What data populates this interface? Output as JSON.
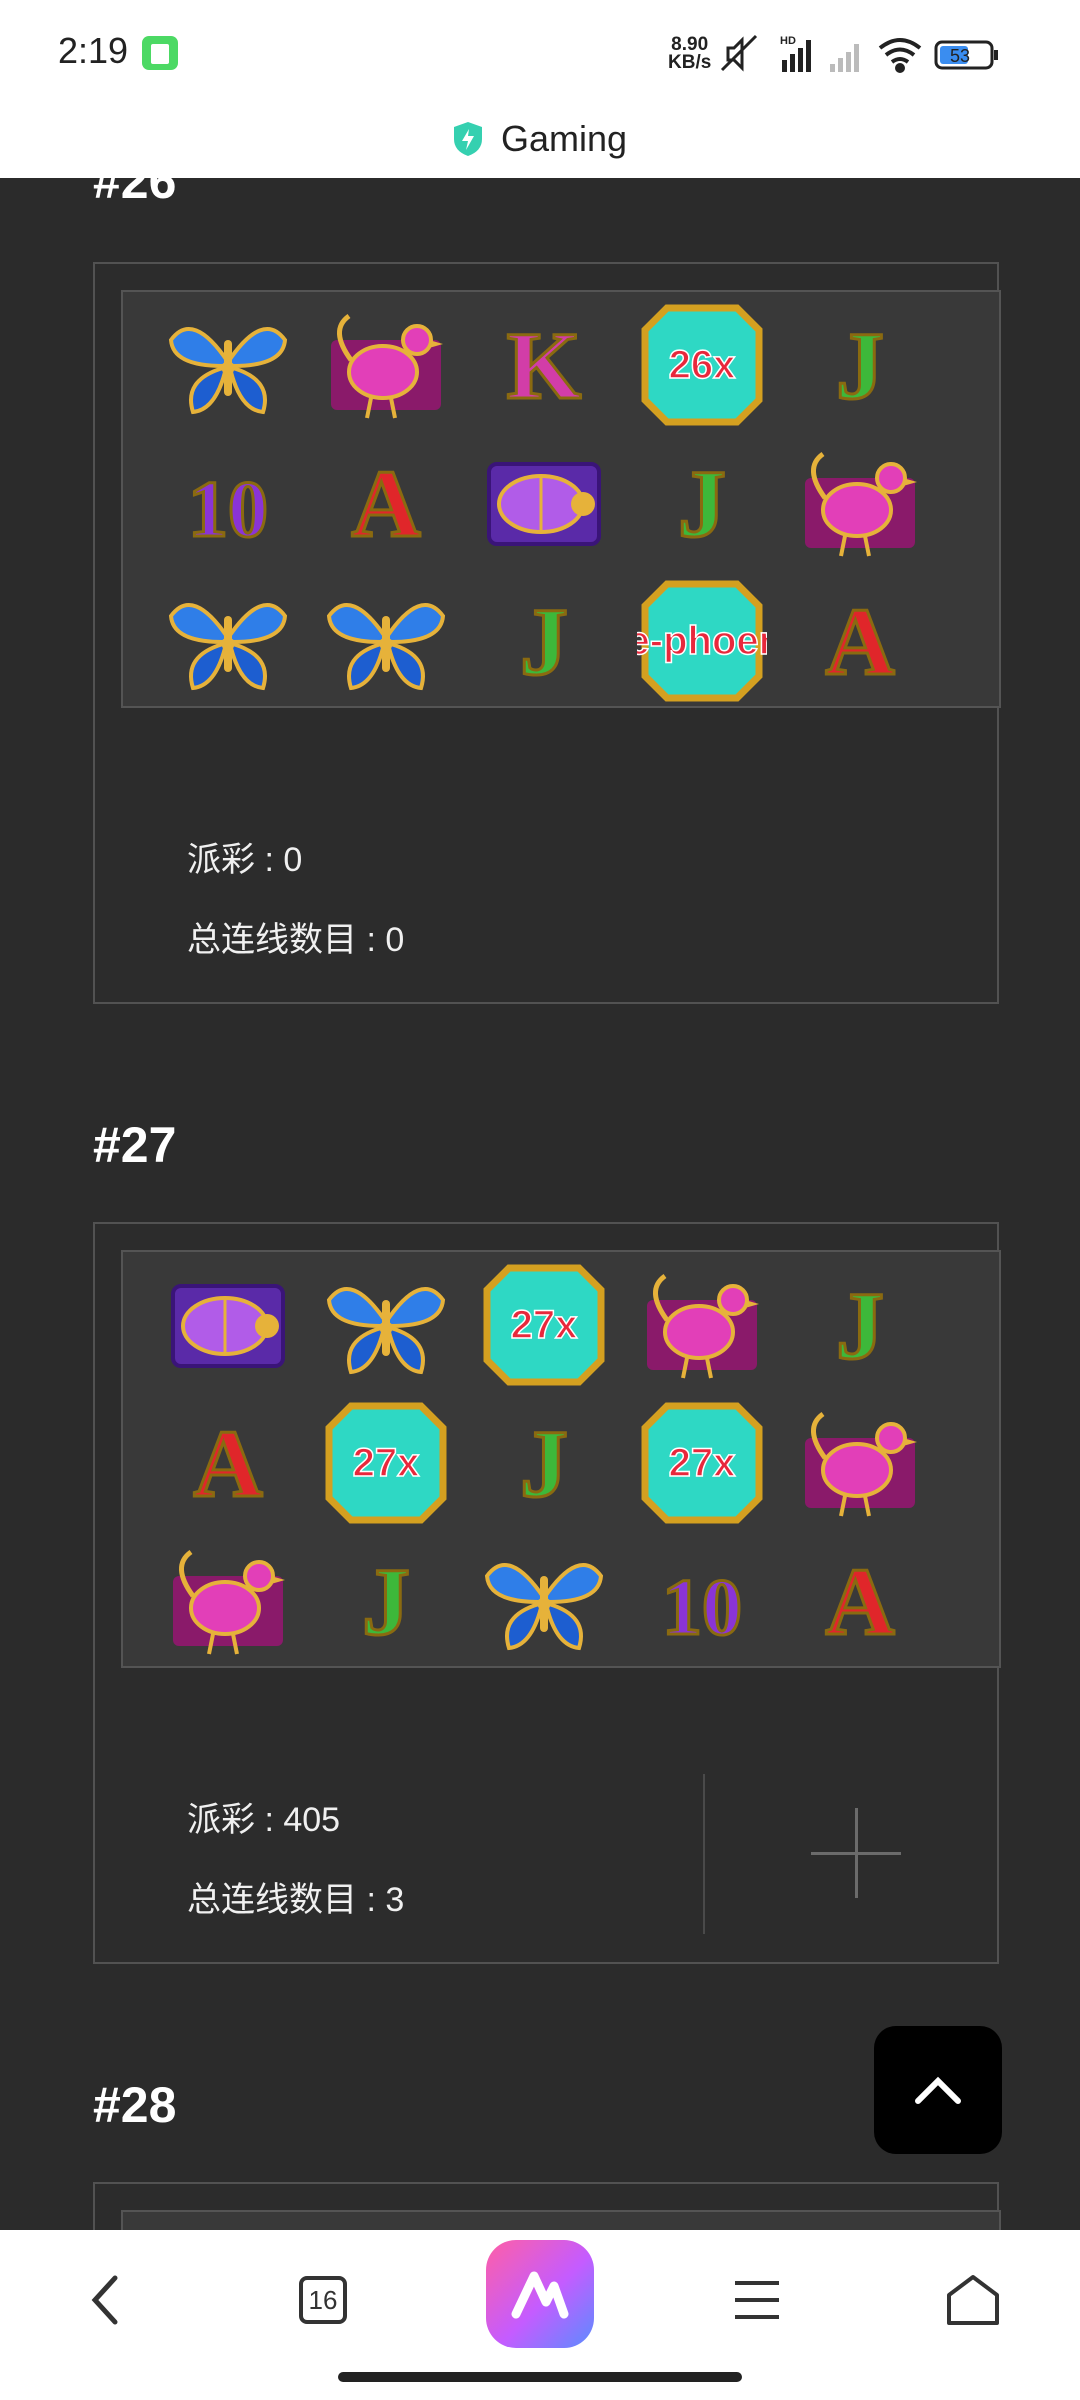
{
  "status": {
    "time": "2:19",
    "net_speed_top": "8.90",
    "net_speed_unit": "KB/s",
    "battery": "53"
  },
  "header": {
    "title": "Gaming"
  },
  "rounds": [
    {
      "title": "#26",
      "symbols": [
        [
          "butterfly",
          "phoenix-bird",
          "K",
          "26x",
          "J"
        ],
        [
          "10",
          "A",
          "beetle",
          "J",
          "phoenix-bird"
        ],
        [
          "butterfly",
          "butterfly",
          "J",
          "fire-phoenix",
          "A"
        ]
      ],
      "payout_label": "派彩 : 0",
      "lines_label": "总连线数目 : 0"
    },
    {
      "title": "#27",
      "symbols": [
        [
          "beetle",
          "butterfly",
          "27x",
          "phoenix-bird",
          "J"
        ],
        [
          "A",
          "27x",
          "J",
          "27x",
          "phoenix-bird"
        ],
        [
          "phoenix-bird",
          "J",
          "butterfly",
          "10",
          "A"
        ]
      ],
      "payout_label": "派彩 : 405",
      "lines_label": "总连线数目 : 3"
    },
    {
      "title": "#28"
    }
  ],
  "nav": {
    "tabs_count": "16"
  },
  "colors": {
    "letter_J": "#3db83a",
    "letter_A": "#e0262a",
    "letter_K": "#d23da8",
    "letter_10": "#8a34d6",
    "multiplier_bg": "#2ed8c4",
    "multiplier_text": "#e8283c"
  }
}
